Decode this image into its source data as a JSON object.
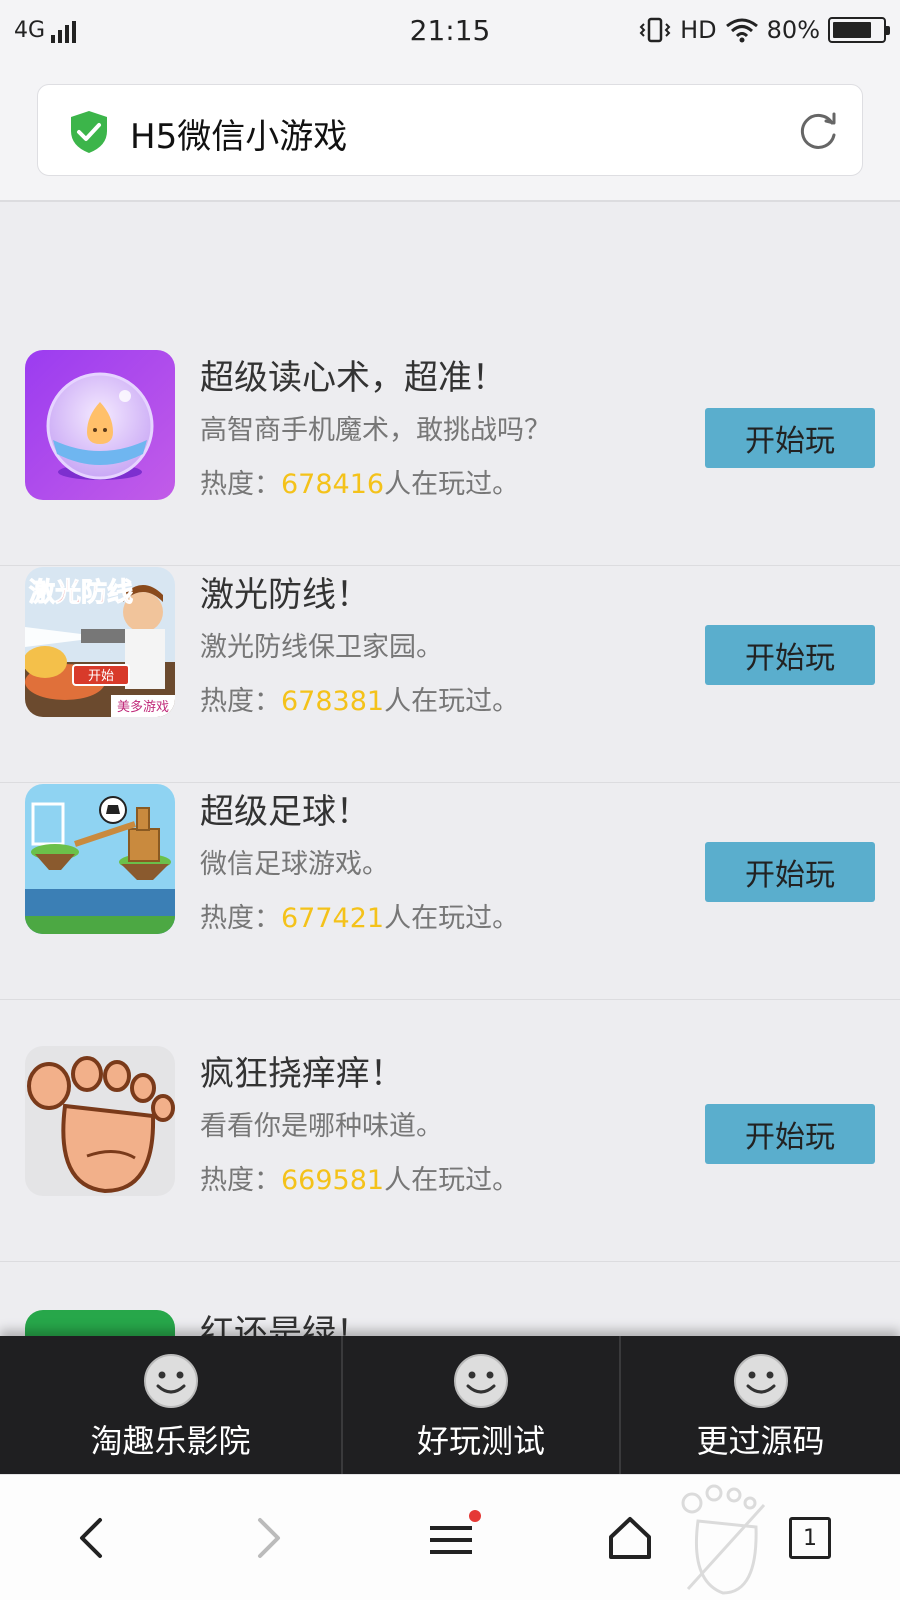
{
  "status_bar": {
    "network": "4G",
    "time": "21:15",
    "hd": "HD",
    "battery": "80%",
    "battery_level": 0.8
  },
  "address_bar": {
    "title": "H5微信小游戏"
  },
  "games": [
    {
      "title": "超级读心术，超准！",
      "desc": "高智商手机魔术，敢挑战吗？",
      "heat_label": "热度：",
      "heat_count": "678416",
      "heat_suffix": "人在玩过。",
      "button": "开始玩"
    },
    {
      "title": "激光防线！",
      "desc": "激光防线保卫家园。",
      "heat_label": "热度：",
      "heat_count": "678381",
      "heat_suffix": "人在玩过。",
      "button": "开始玩",
      "thumb_text": {
        "banner": "激光防线",
        "start": "开始",
        "brand": "美多游戏"
      }
    },
    {
      "title": "超级足球！",
      "desc": "微信足球游戏。",
      "heat_label": "热度：",
      "heat_count": "677421",
      "heat_suffix": "人在玩过。",
      "button": "开始玩"
    },
    {
      "title": "疯狂挠痒痒！",
      "desc": "看看你是哪种味道。",
      "heat_label": "热度：",
      "heat_count": "669581",
      "heat_suffix": "人在玩过。",
      "button": "开始玩"
    },
    {
      "title": "红还是绿！"
    }
  ],
  "web_menu": [
    {
      "label": "淘趣乐影院",
      "icon": "smiley-icon"
    },
    {
      "label": "好玩测试",
      "icon": "smiley-icon"
    },
    {
      "label": "更过源码",
      "icon": "smiley-icon"
    }
  ],
  "browser_nav": {
    "tab_count": "1",
    "icons": [
      "back-arrow-icon",
      "forward-arrow-icon",
      "menu-icon",
      "home-icon",
      "tabs-icon"
    ],
    "colors": {
      "notification_dot": "#e53935"
    }
  },
  "colors": {
    "accent_button": "#5aaecd",
    "heat_count": "#f4c21a",
    "shield": "#3cb54a",
    "menu_bg": "#1f1f21"
  }
}
